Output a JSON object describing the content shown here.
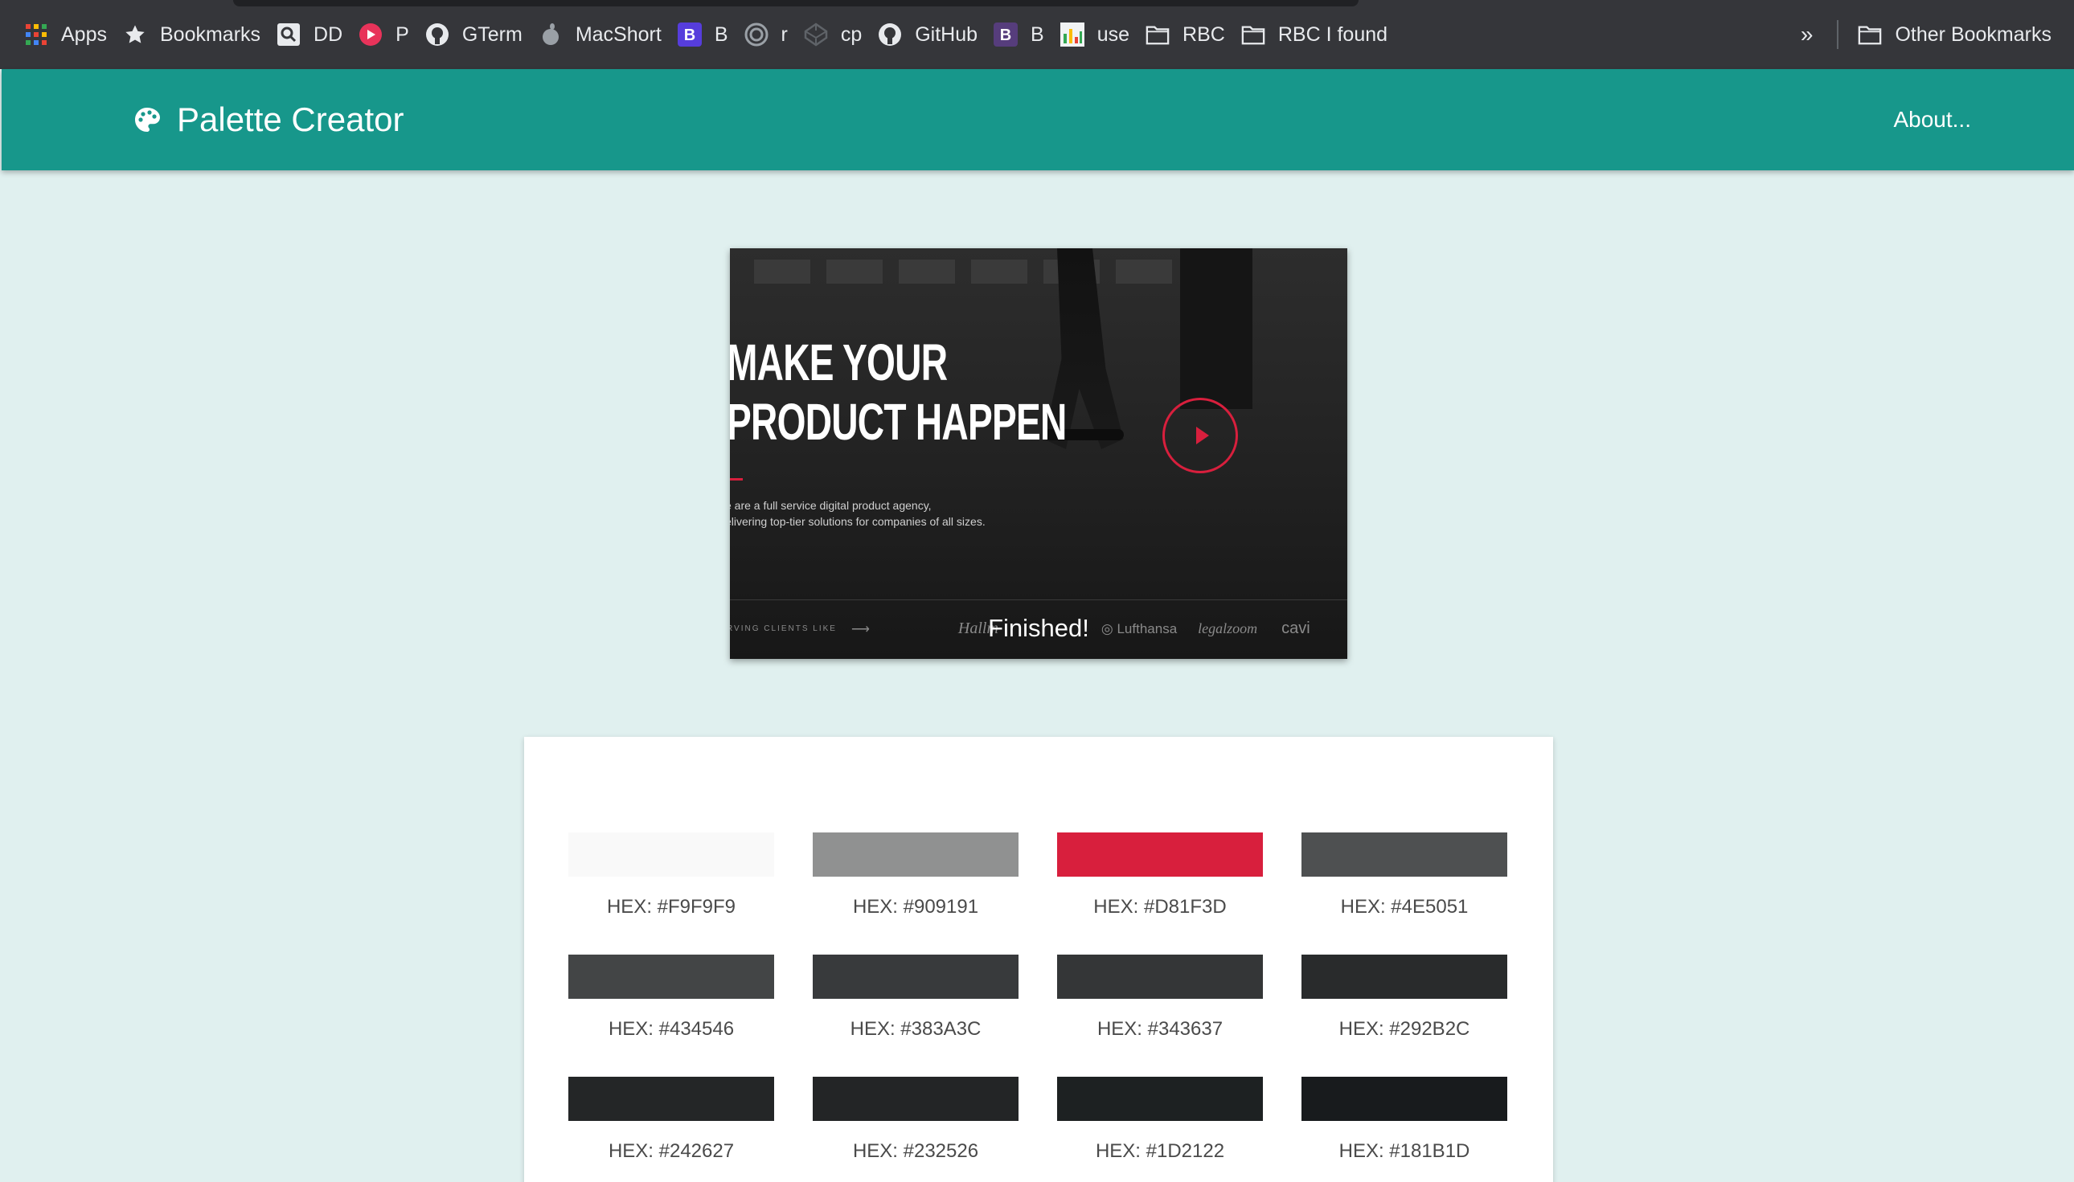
{
  "bookmarks": [
    {
      "label": "Apps",
      "icon": "apps-grid-icon"
    },
    {
      "label": "Bookmarks",
      "icon": "star-icon"
    },
    {
      "label": "DD",
      "icon": "search-icon"
    },
    {
      "label": "P",
      "icon": "play-circle-icon"
    },
    {
      "label": "GTerm",
      "icon": "github-icon"
    },
    {
      "label": "MacShort",
      "icon": "apple-icon"
    },
    {
      "label": "B",
      "icon": "bootstrap-icon"
    },
    {
      "label": "r",
      "icon": "spiral-icon"
    },
    {
      "label": "cp",
      "icon": "codepen-icon"
    },
    {
      "label": "GitHub",
      "icon": "github-icon"
    },
    {
      "label": "B",
      "icon": "bootstrap-icon"
    },
    {
      "label": "use",
      "icon": "chart-thumbnail-icon"
    },
    {
      "label": "RBC",
      "icon": "folder-icon"
    },
    {
      "label": "RBC I found",
      "icon": "folder-icon"
    }
  ],
  "bookmarks_overflow": "»",
  "other_bookmarks": "Other Bookmarks",
  "app": {
    "title": "Palette Creator",
    "about": "About..."
  },
  "preview": {
    "headline_line1": "MAKE YOUR",
    "headline_line2": "PRODUCT HAPPEN",
    "sub_line1": "e are a full service digital product agency,",
    "sub_line2": "elivering top-tier solutions for companies of all sizes.",
    "serving": "RVING CLIENTS LIKE",
    "logo1": "Hallm",
    "logo2": "Lufthansa",
    "logo3": "legalzoom",
    "logo4": "cavi",
    "status": "Finished!"
  },
  "palette": [
    {
      "label": "HEX: #F9F9F9",
      "color": "#F9F9F9"
    },
    {
      "label": "HEX: #909191",
      "color": "#909191"
    },
    {
      "label": "HEX: #D81F3D",
      "color": "#D81F3D"
    },
    {
      "label": "HEX: #4E5051",
      "color": "#4E5051"
    },
    {
      "label": "HEX: #434546",
      "color": "#434546"
    },
    {
      "label": "HEX: #383A3C",
      "color": "#383A3C"
    },
    {
      "label": "HEX: #343637",
      "color": "#343637"
    },
    {
      "label": "HEX: #292B2C",
      "color": "#292B2C"
    },
    {
      "label": "HEX: #242627",
      "color": "#242627"
    },
    {
      "label": "HEX: #232526",
      "color": "#232526"
    },
    {
      "label": "HEX: #1D2122",
      "color": "#1D2122"
    },
    {
      "label": "HEX: #181B1D",
      "color": "#181B1D"
    }
  ],
  "colors": {
    "header": "#17978b",
    "background": "#e0f0ef",
    "accent": "#d81f3d"
  }
}
